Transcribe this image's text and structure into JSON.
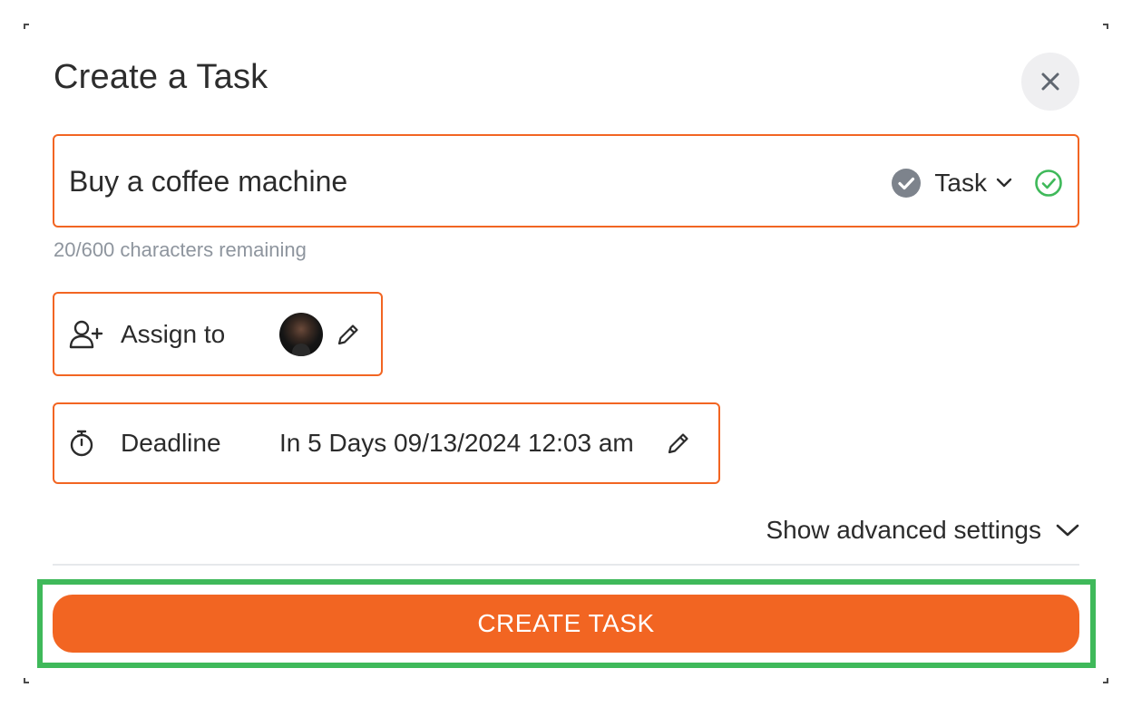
{
  "dialog": {
    "title": "Create a Task",
    "close_icon": "close-icon"
  },
  "task": {
    "name_value": "Buy a coffee machine",
    "type_label": "Task",
    "type_icon": "check-circle-icon",
    "valid_icon": "check-circle-outline-icon",
    "char_count": "20/600 characters remaining"
  },
  "assign": {
    "label": "Assign to",
    "icon": "user-plus-icon",
    "edit_icon": "pencil-icon"
  },
  "deadline": {
    "label": "Deadline",
    "value": "In 5 Days 09/13/2024 12:03 am",
    "icon": "stopwatch-icon",
    "edit_icon": "pencil-icon"
  },
  "advanced": {
    "label": "Show advanced settings",
    "icon": "chevron-down-icon"
  },
  "actions": {
    "create_label": "CREATE TASK"
  },
  "colors": {
    "accent": "#f26522",
    "highlight": "#3fb95a",
    "muted_text": "#8e959e",
    "valid": "#3fb95a"
  }
}
